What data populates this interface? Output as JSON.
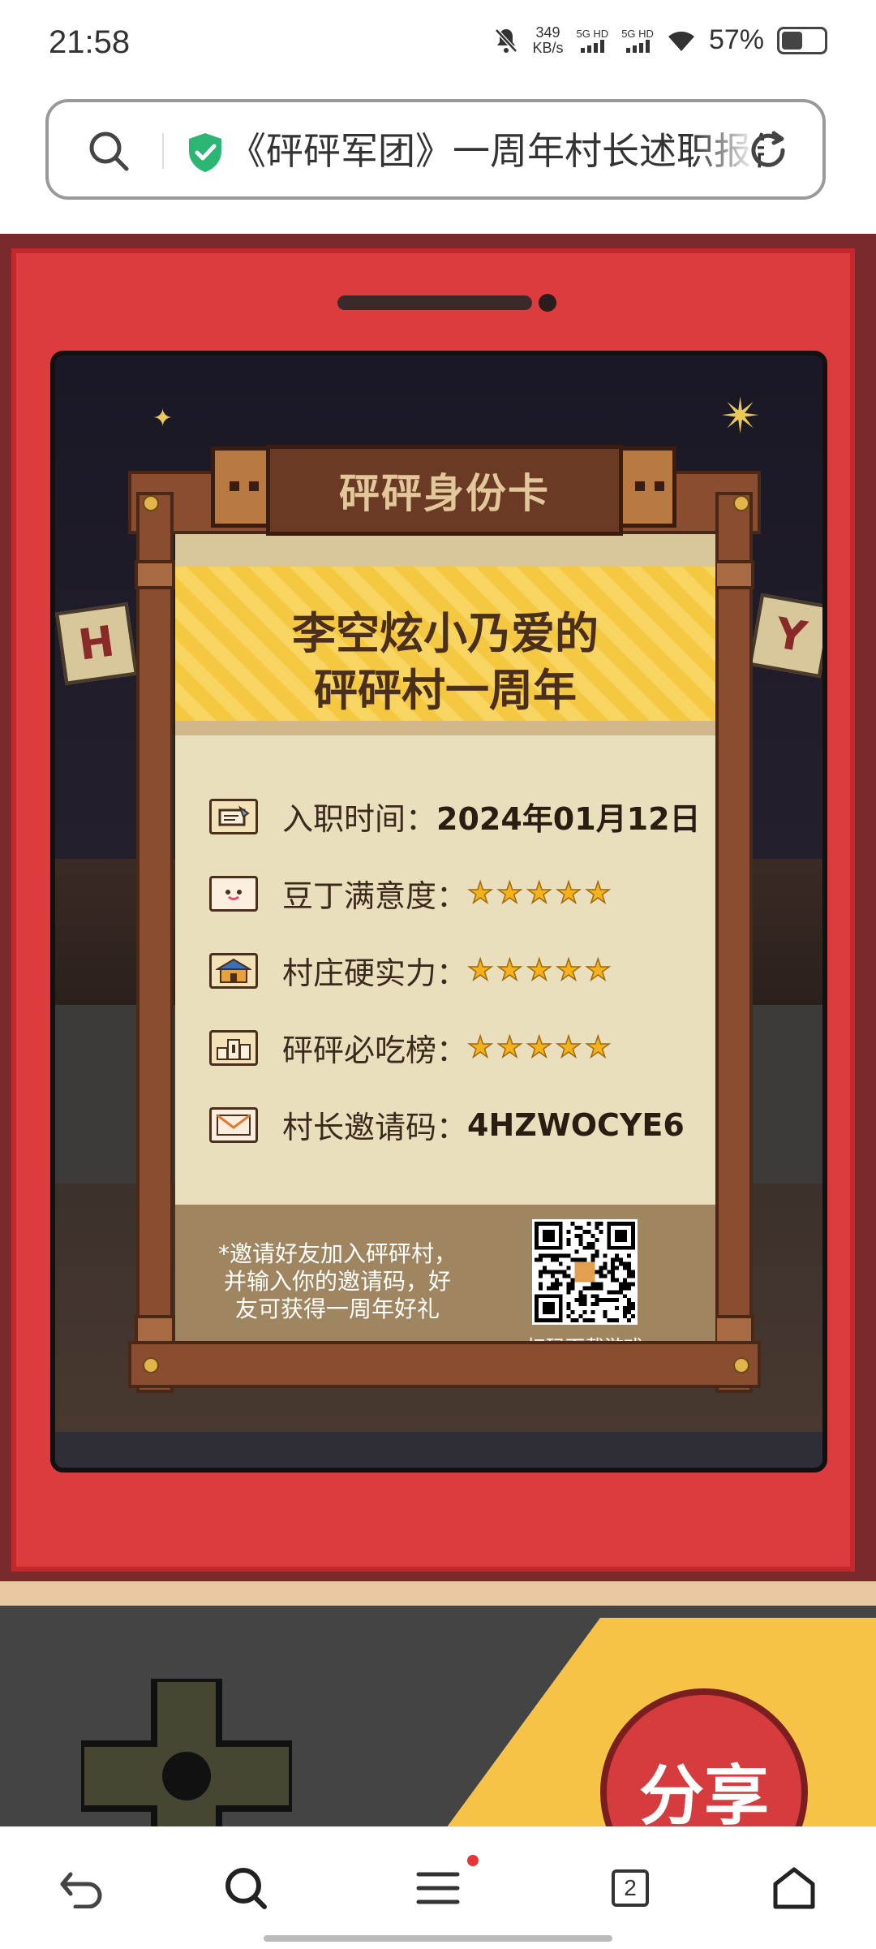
{
  "status_bar": {
    "time": "21:58",
    "net_speed_value": "349",
    "net_speed_unit": "KB/s",
    "sim1": "5G HD",
    "sim2": "5G HD",
    "battery_percent": "57%",
    "battery_level": 0.57
  },
  "address_bar": {
    "title": "《砰砰军团》一周年村长述职报告"
  },
  "card": {
    "plate_title": "砰砰身份卡",
    "headline_line1": "李空炫小乃爱的",
    "headline_line2": "砰砰村一周年",
    "rows": [
      {
        "label": "入职时间：",
        "value": "2024年01月12日",
        "icon": "ticket-icon"
      },
      {
        "label": "豆丁满意度：",
        "stars": 5,
        "icon": "face-icon"
      },
      {
        "label": "村庄硬实力：",
        "stars": 5,
        "icon": "house-icon"
      },
      {
        "label": "砰砰必吃榜：",
        "stars": 5,
        "icon": "podium-icon"
      },
      {
        "label": "村长邀请码：",
        "value": "4HZWOCYE6",
        "icon": "envelope-icon"
      }
    ],
    "footer_note": "*邀请好友加入砰砰村，并输入你的邀请码，好友可获得一周年好礼",
    "qr_label": "扫码下载游戏"
  },
  "banner_letters": {
    "left": "H",
    "right": "Y"
  },
  "share_button": "分享",
  "bottom_nav": {
    "tab_count": "2",
    "items": [
      "back-icon",
      "search-icon",
      "menu-icon",
      "tabs-icon",
      "home-icon"
    ]
  },
  "colors": {
    "device_red": "#dd3c3f",
    "paper": "#eadfbd",
    "star": "#f4b21a",
    "accent_green": "#2bb673"
  }
}
